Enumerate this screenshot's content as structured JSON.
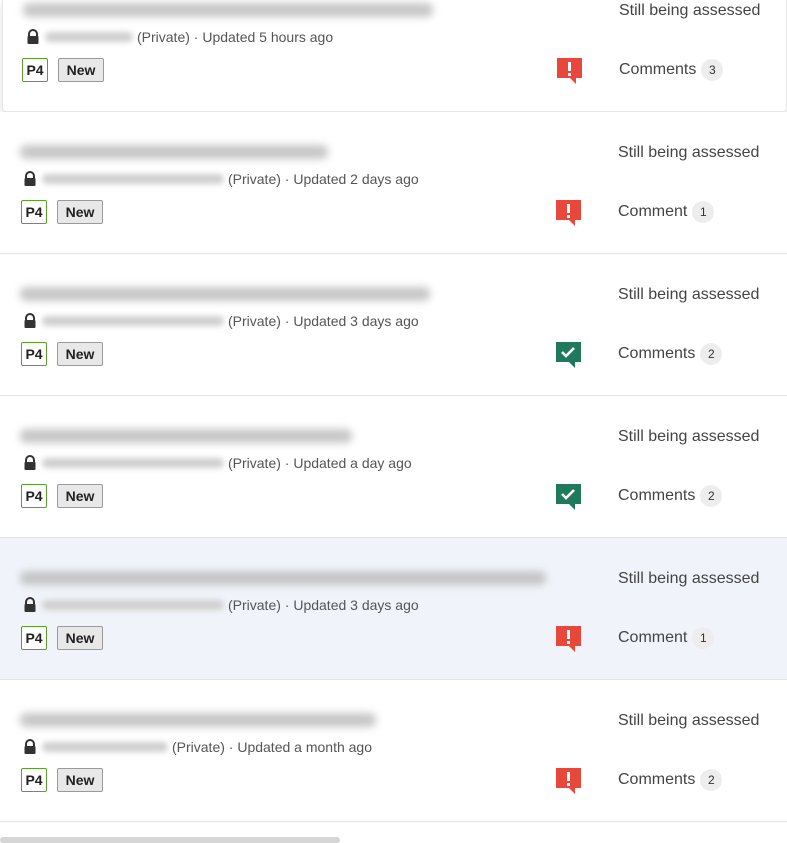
{
  "reports": [
    {
      "status": "Still being assessed",
      "meta": "(Private) · Updated 5 hours ago",
      "priority": "P4",
      "state": "New",
      "flag": "alert",
      "comments_label": "Comments",
      "comments_count": "3"
    },
    {
      "status": "Still being assessed",
      "meta": "(Private) · Updated 2 days ago",
      "priority": "P4",
      "state": "New",
      "flag": "alert",
      "comments_label": "Comment",
      "comments_count": "1"
    },
    {
      "status": "Still being assessed",
      "meta": "(Private) · Updated 3 days ago",
      "priority": "P4",
      "state": "New",
      "flag": "check",
      "comments_label": "Comments",
      "comments_count": "2"
    },
    {
      "status": "Still being assessed",
      "meta": "(Private) · Updated a day ago",
      "priority": "P4",
      "state": "New",
      "flag": "check",
      "comments_label": "Comments",
      "comments_count": "2"
    },
    {
      "status": "Still being assessed",
      "meta": "(Private) · Updated 3 days ago",
      "priority": "P4",
      "state": "New",
      "flag": "alert",
      "comments_label": "Comment",
      "comments_count": "1"
    },
    {
      "status": "Still being assessed",
      "meta": "(Private) · Updated a month ago",
      "priority": "P4",
      "state": "New",
      "flag": "alert",
      "comments_label": "Comments",
      "comments_count": "2"
    }
  ],
  "colors": {
    "alert_flag": "#e8473b",
    "check_flag": "#1f7a5c",
    "priority_border": "#5aa02c",
    "highlight_row": "#f0f4fa"
  },
  "icons": {
    "lock": "lock-icon",
    "alert": "alert-flag-icon",
    "check": "check-flag-icon"
  }
}
